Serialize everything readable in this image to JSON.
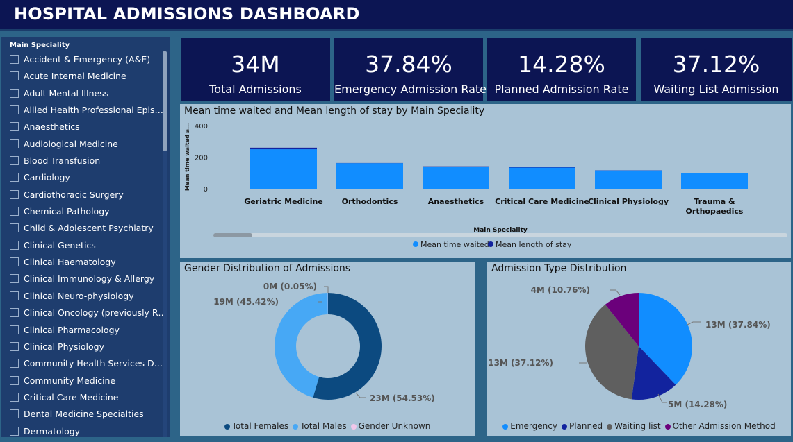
{
  "header": {
    "title": "HOSPITAL ADMISSIONS DASHBOARD"
  },
  "colors": {
    "navy": "#0c1553",
    "page_bg": "#2d6488",
    "panel_bg": "#a9c3d6",
    "accent_blue": "#118dff",
    "dark_blue": "#12239e"
  },
  "slicer": {
    "title": "Main Speciality",
    "items": [
      "Accident & Emergency (A&E)",
      "Acute Internal Medicine",
      "Adult Mental Illness",
      "Allied Health Professional Episode",
      "Anaesthetics",
      "Audiological Medicine",
      "Blood Transfusion",
      "Cardiology",
      "Cardiothoracic Surgery",
      "Chemical Pathology",
      "Child & Adolescent Psychiatry",
      "Clinical Genetics",
      "Clinical Haematology",
      "Clinical Immunology & Allergy",
      "Clinical Neuro-physiology",
      "Clinical Oncology (previously Rad...",
      "Clinical Pharmacology",
      "Clinical Physiology",
      "Community Health Services Dental",
      "Community Medicine",
      "Critical Care Medicine",
      "Dental Medicine Specialties",
      "Dermatology"
    ]
  },
  "kpis": [
    {
      "value": "34M",
      "label": "Total Admissions"
    },
    {
      "value": "37.84%",
      "label": "Emergency Admission Rate"
    },
    {
      "value": "14.28%",
      "label": "Planned Admission Rate"
    },
    {
      "value": "37.12%",
      "label": "Waiting List Admission"
    }
  ],
  "chart_data": [
    {
      "type": "bar",
      "title": "Mean time waited and Mean length of stay by Main Speciality",
      "xlabel": "Main Speciality",
      "ylabel": "Mean time waited a...",
      "ylim": [
        0,
        400
      ],
      "yticks": [
        "400",
        "200",
        "0"
      ],
      "stacked": true,
      "categories": [
        "Geriatric Medicine",
        "Orthodontics",
        "Anaesthetics",
        "Critical Care Medicine",
        "Clinical Physiology",
        "Trauma & Orthopaedics"
      ],
      "category_lines": [
        [
          "Geriatric Medicine"
        ],
        [
          "Orthodontics"
        ],
        [
          "Anaesthetics"
        ],
        [
          "Critical Care Medicine"
        ],
        [
          "Clinical Physiology"
        ],
        [
          "Trauma &",
          "Orthopaedics"
        ]
      ],
      "series": [
        {
          "name": "Mean time waited",
          "color": "#118dff",
          "values": [
            250,
            162,
            140,
            134,
            116,
            97
          ]
        },
        {
          "name": "Mean length of stay",
          "color": "#12239e",
          "values": [
            10,
            1,
            2,
            3,
            1,
            2
          ]
        }
      ],
      "legend": "bottom-center"
    },
    {
      "type": "pie",
      "variant": "donut",
      "title": "Gender Distribution of Admissions",
      "slices": [
        {
          "name": "Total Females",
          "value": 54.53,
          "label": "23M (54.53%)",
          "color": "#0c4a80"
        },
        {
          "name": "Total Males",
          "value": 45.42,
          "label": "19M (45.42%)",
          "color": "#47a8f5"
        },
        {
          "name": "Gender Unknown",
          "value": 0.05,
          "label": "0M (0.05%)",
          "color": "#f1c7ea"
        }
      ],
      "legend": "bottom-center"
    },
    {
      "type": "pie",
      "title": "Admission Type Distribution",
      "slices": [
        {
          "name": "Emergency",
          "value": 37.84,
          "label": "13M (37.84%)",
          "color": "#118dff"
        },
        {
          "name": "Planned",
          "value": 14.28,
          "label": "5M (14.28%)",
          "color": "#12239e"
        },
        {
          "name": "Waiting list",
          "value": 37.12,
          "label": "13M (37.12%)",
          "color": "#5f5f5f"
        },
        {
          "name": "Other Admission Method",
          "value": 10.76,
          "label": "4M (10.76%)",
          "color": "#6b007b"
        }
      ],
      "legend": "bottom-center"
    }
  ]
}
